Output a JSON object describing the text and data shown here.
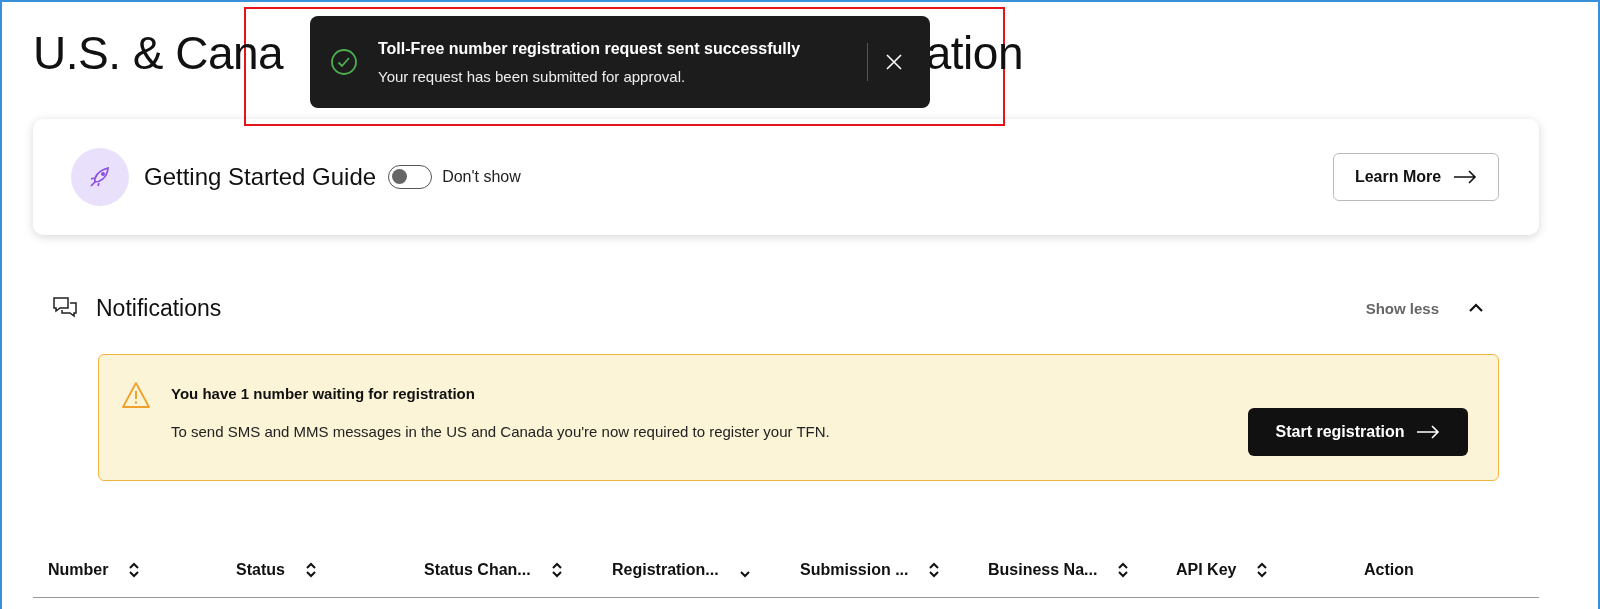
{
  "page_title": {
    "visible_start": "U.S. & Cana",
    "visible_end": "ation"
  },
  "toast": {
    "kind": "success",
    "title": "Toll-Free number registration request sent successfully",
    "message": "Your request has been submitted for approval."
  },
  "guide": {
    "title": "Getting Started Guide",
    "toggle": {
      "label": "Don't show",
      "on": false
    },
    "button": "Learn More"
  },
  "notifications": {
    "title": "Notifications",
    "toggle_label": "Show less",
    "expanded": true,
    "alert": {
      "title": "You have 1 number waiting for registration",
      "message": "To send SMS and MMS messages in the US and Canada you're now required to register your TFN.",
      "button": "Start registration"
    }
  },
  "table": {
    "columns": [
      {
        "label": "Number",
        "kind": "sortable"
      },
      {
        "label": "Status",
        "kind": "sortable"
      },
      {
        "label": "Status Chan...",
        "kind": "sortable"
      },
      {
        "label": "Registration...",
        "kind": "sorted"
      },
      {
        "label": "Submission ...",
        "kind": "sortable"
      },
      {
        "label": "Business Na...",
        "kind": "sortable"
      },
      {
        "label": "API Key",
        "kind": "sortable"
      },
      {
        "label": "Action",
        "kind": "plain"
      }
    ]
  }
}
